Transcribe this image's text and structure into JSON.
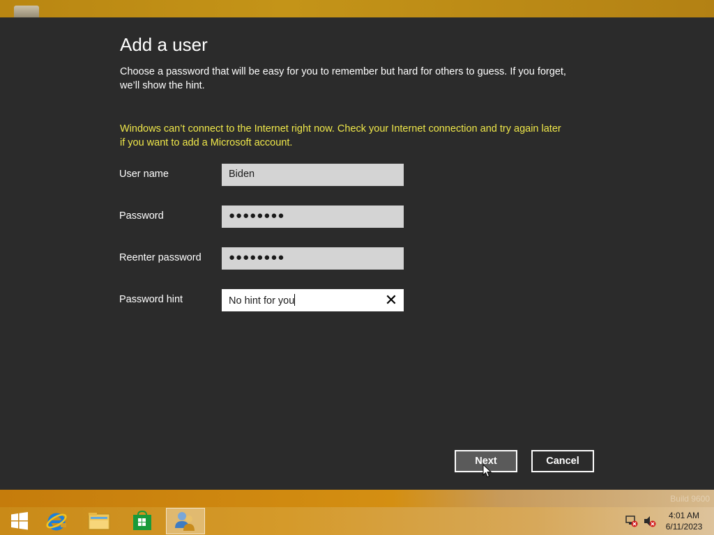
{
  "dialog": {
    "title": "Add a user",
    "description": "Choose a password that will be easy for you to remember but hard for others to guess. If you forget, we’ll show the hint.",
    "warning": "Windows can’t connect to the Internet right now. Check your Internet connection and try again later if you want to add a Microsoft account.",
    "fields": {
      "username": {
        "label": "User name",
        "value": "Biden"
      },
      "password": {
        "label": "Password",
        "value": "●●●●●●●●"
      },
      "reenter": {
        "label": "Reenter password",
        "value": "●●●●●●●●"
      },
      "hint": {
        "label": "Password hint",
        "value": "No hint for you"
      }
    },
    "buttons": {
      "next": "Next",
      "cancel": "Cancel"
    }
  },
  "watermark": "Build 9600",
  "taskbar": {
    "items": [
      "start-icon",
      "internet-explorer-icon",
      "file-explorer-icon",
      "store-icon",
      "user-accounts-icon"
    ],
    "clock": {
      "time": "4:01 AM",
      "date": "6/11/2023"
    }
  },
  "colors": {
    "dialog_bg": "#2b2b2b",
    "warning": "#f0e84a",
    "field_bg": "#d4d4d4",
    "taskbar": "#d59a2a"
  }
}
